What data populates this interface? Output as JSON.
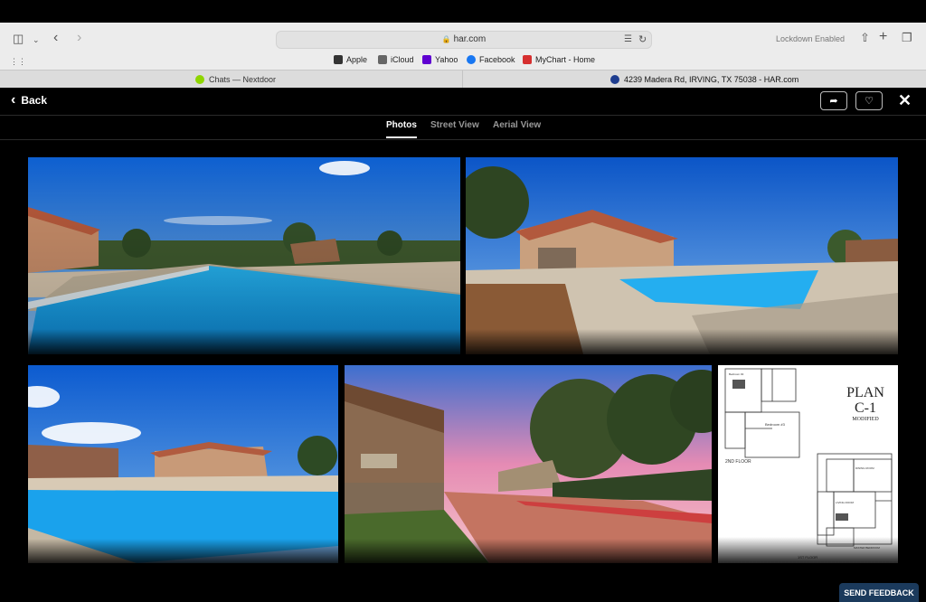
{
  "browser": {
    "url": "har.com",
    "lockdown_label": "Lockdown Enabled",
    "favorites": [
      {
        "label": "Apple",
        "color": "#333333"
      },
      {
        "label": "iCloud",
        "color": "#666666"
      },
      {
        "label": "Yahoo",
        "color": "#5f01d1"
      },
      {
        "label": "Facebook",
        "color": "#1877f2"
      },
      {
        "label": "MyChart - Home",
        "color": "#d62f2f"
      }
    ],
    "tabs": [
      {
        "label": "Chats — Nextdoor",
        "icon_color": "#8ed500"
      },
      {
        "label": "4239 Madera Rd, IRVING, TX 75038 - HAR.com",
        "icon_color": "#1e3d8f"
      }
    ]
  },
  "header": {
    "back_label": "Back",
    "share_icon": "share-arrow-icon",
    "favorite_icon": "heart-icon",
    "close_icon": "close-x-icon"
  },
  "view_tabs": [
    {
      "label": "Photos",
      "active": true
    },
    {
      "label": "Street View",
      "active": false
    },
    {
      "label": "Aerial View",
      "active": false
    }
  ],
  "floorplan": {
    "title_line1": "PLAN",
    "title_line2": "C-1",
    "subtitle": "MODIFIED",
    "floor_2": "2ND FLOOR",
    "floor_1": "1ST FLOOR",
    "bedroom2": "Bedroom #2",
    "bedroom3": "Bedroom #3",
    "living": "LIVING ROOM",
    "dining": "DINING ROOM",
    "master": "MASTER BEDROOM"
  },
  "feedback_label": "SEND FEEDBACK",
  "colors": {
    "sky": "#1a6fd6",
    "pool": "#1a9ee8",
    "accent_navy": "#1b3a5c"
  }
}
